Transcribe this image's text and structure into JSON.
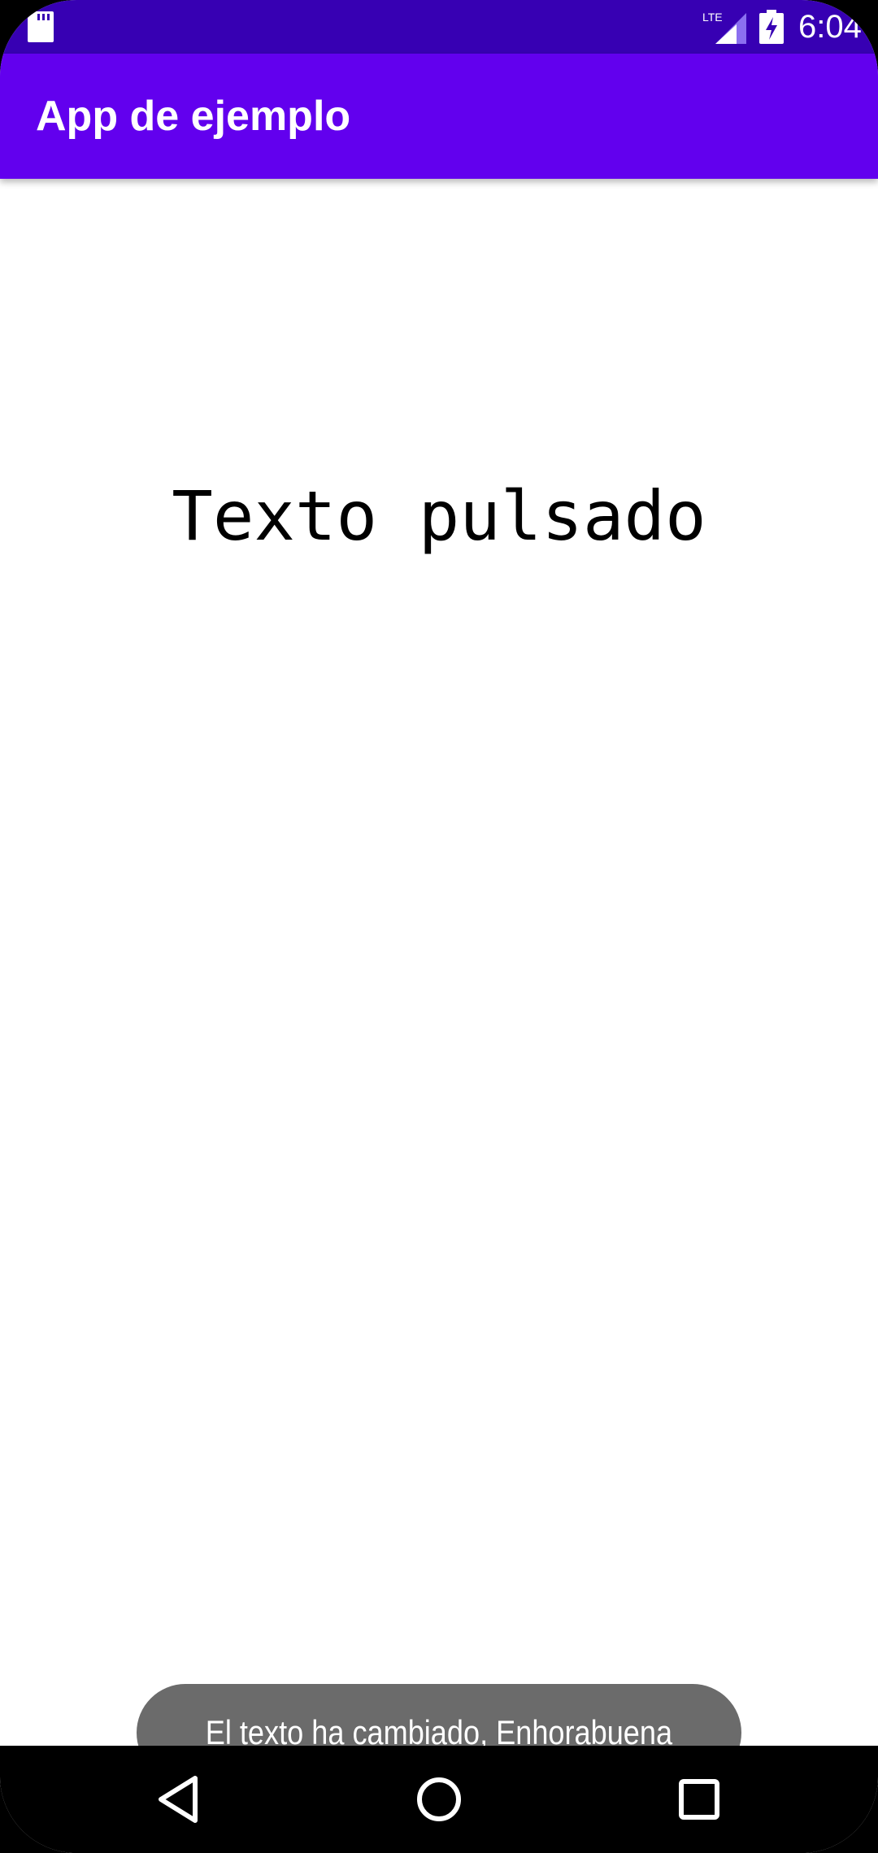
{
  "status_bar": {
    "time": "6:04",
    "network_label": "LTE",
    "icons": [
      "sd-card-icon",
      "signal-icon",
      "battery-charging-icon"
    ],
    "color": "#3700b3"
  },
  "app_bar": {
    "title": "App de ejemplo",
    "color": "#6200ee"
  },
  "main": {
    "text": "Texto pulsado"
  },
  "toast": {
    "message": "El texto ha cambiado, Enhorabuena"
  },
  "nav_bar": {
    "buttons": [
      "back-icon",
      "home-icon",
      "recents-icon"
    ]
  }
}
